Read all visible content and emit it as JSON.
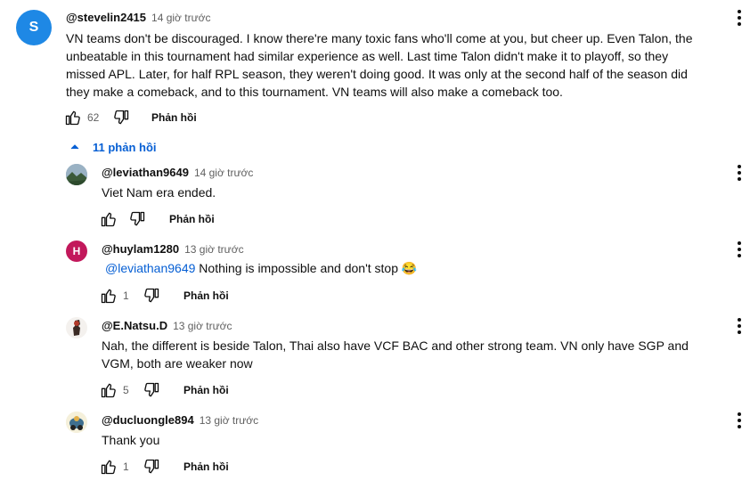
{
  "top_comment": {
    "avatar_letter": "S",
    "avatar_color": "#1e88e5",
    "handle": "@stevelin2415",
    "time": "14 giờ trước",
    "lines": [
      "VN teams don't be discouraged. I know there're many toxic fans who'll come at you, but cheer up. Even Talon, the",
      "unbeatable in this tournament had similar experience as well. Last time Talon didn't make it to playoff, so they",
      "missed APL. Later, for half RPL season, they weren't doing good. It was only at the second half of the season did",
      "they make a comeback, and to this tournament. VN teams will also make a comeback too."
    ],
    "likes": "62",
    "reply_label": "Phản hồi"
  },
  "replies_toggle": {
    "label": "11 phản hồi",
    "color": "#065fd4"
  },
  "replies": [
    {
      "avatar": "landscape-avatar",
      "handle": "@leviathan9649",
      "time": "14 giờ trước",
      "mention": "",
      "text": "Viet Nam era ended.",
      "likes": "",
      "reply_label": "Phản hồi"
    },
    {
      "avatar_letter": "H",
      "avatar_color": "#c2185b",
      "handle": "@huylam1280",
      "time": "13 giờ trước",
      "mention": "@leviathan9649",
      "text": " Nothing is impossible and don't stop 😂",
      "likes": "1",
      "reply_label": "Phản hồi"
    },
    {
      "avatar": "character-avatar",
      "handle": "@E.Natsu.D",
      "time": "13 giờ trước",
      "mention": "",
      "lines": [
        "Nah, the different is beside Talon, Thai also have VCF BAC and other strong team. VN only have SGP and",
        "VGM, both are weaker now"
      ],
      "likes": "5",
      "reply_label": "Phản hồi"
    },
    {
      "avatar": "cartoon-avatar",
      "handle": "@ducluongle894",
      "time": "13 giờ trước",
      "mention": "",
      "text": "Thank you",
      "likes": "1",
      "reply_label": "Phản hồi"
    }
  ]
}
